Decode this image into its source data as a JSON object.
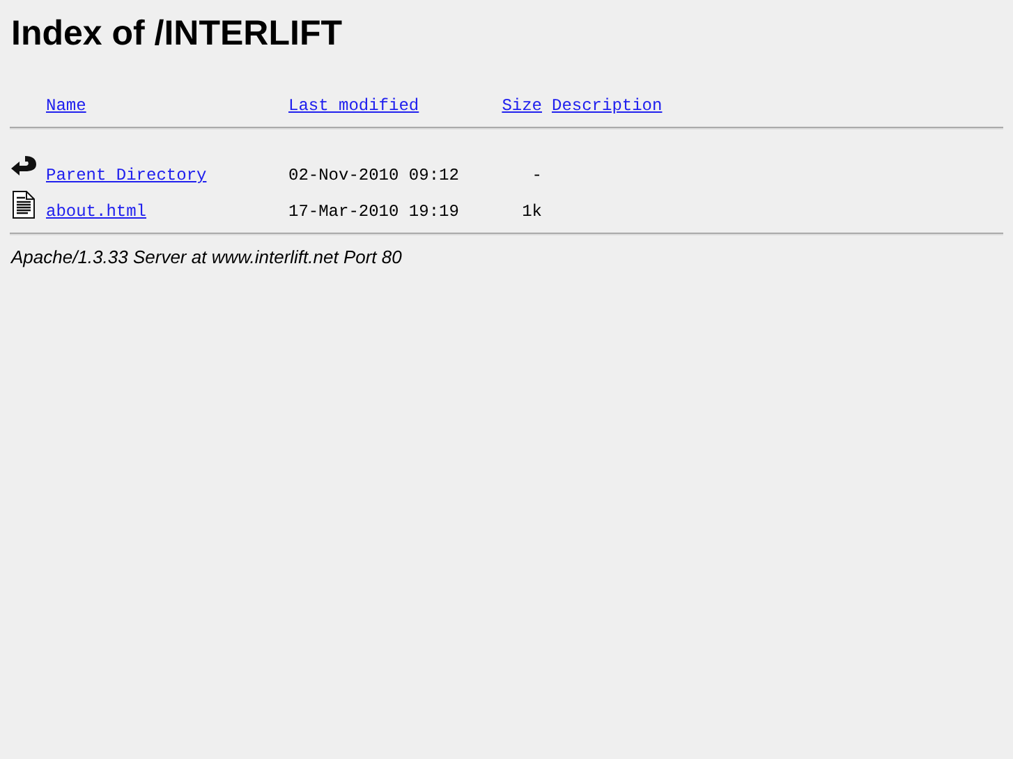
{
  "title": "Index of /INTERLIFT",
  "columns": [
    "Name",
    "Last modified",
    "Size",
    "Description"
  ],
  "rows": [
    {
      "kind": "back",
      "name": "Parent Directory",
      "modified": "02-Nov-2010 09:12",
      "size": "-"
    },
    {
      "kind": "text",
      "name": "about.html",
      "modified": "17-Mar-2010 19:19",
      "size": "1k"
    }
  ],
  "footer": "Apache/1.3.33 Server at www.interlift.net Port 80"
}
